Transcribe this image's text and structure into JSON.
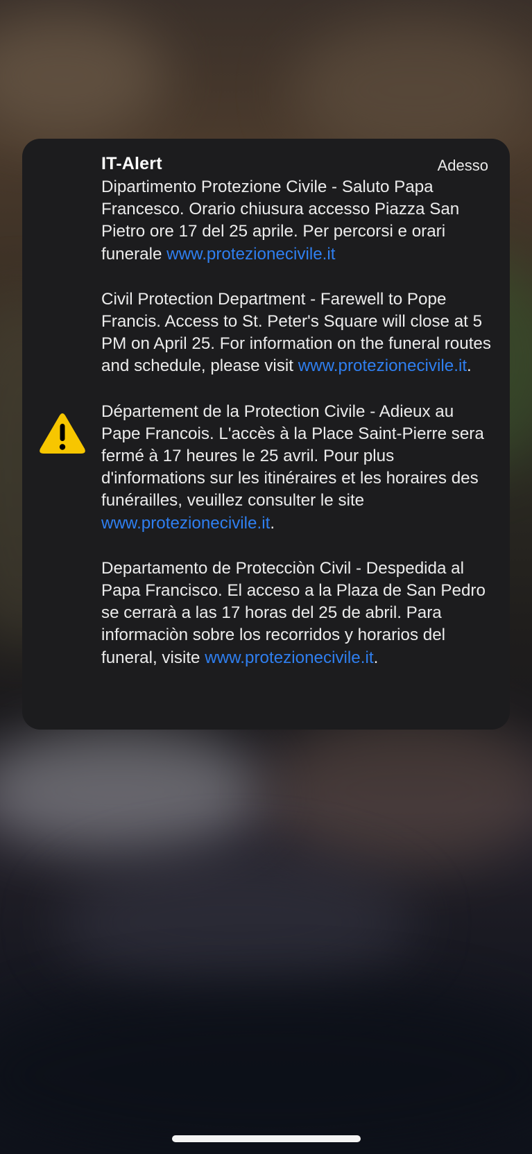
{
  "alert": {
    "app_name": "IT-Alert",
    "time": "Adesso",
    "icon": "warning-triangle-icon",
    "paragraphs": [
      {
        "text": "Dipartimento Protezione Civile - Saluto Papa Francesco. Orario chiusura accesso Piazza San Pietro ore 17 del 25 aprile. Per percorsi e orari funerale ",
        "link": "www.protezionecivile.it",
        "after": ""
      },
      {
        "text": "Civil Protection Department - Farewell to Pope Francis. Access to St. Peter's Square will close at 5 PM on April 25. For information on the funeral routes and schedule, please visit ",
        "link": "www.protezionecivile.it",
        "after": "."
      },
      {
        "text": "Département de la Protection Civile - Adieux au Pape Francois. L'accès à la Place Saint-Pierre sera fermé à 17 heures le 25 avril. Pour plus d'informations sur les itinéraires et les horaires des funérailles, veuillez consulter le site ",
        "link": "www.protezionecivile.it",
        "after": "."
      },
      {
        "text": "Departamento de Protecciòn Civil - Despedida al Papa Francisco. El acceso a la Plaza de San Pedro se cerrarà a las 17 horas del 25 de abril. Para informaciòn sobre los recorridos y horarios del funeral, visite ",
        "link": "www.protezionecivile.it",
        "after": "."
      }
    ]
  },
  "colors": {
    "card_background": "#1c1c1e",
    "link": "#2f7ff0",
    "warning_yellow": "#f7c600"
  }
}
